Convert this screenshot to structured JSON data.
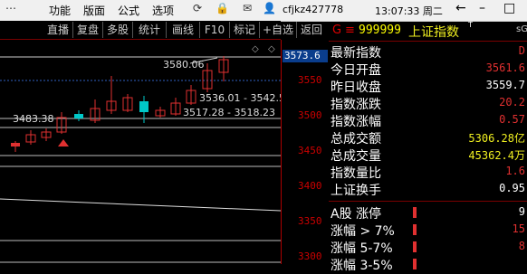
{
  "menu": {
    "items": [
      "功能",
      "版面",
      "公式",
      "选项"
    ],
    "user": "cfjkz427778",
    "clock": "13:07:33 周二",
    "win_min": "–",
    "win_max": "□"
  },
  "toolbar": [
    "直播",
    "复盘",
    "多股",
    "统计",
    "画线",
    "F10",
    "标记",
    "+自选",
    "返回"
  ],
  "axis": {
    "current": "3573.6",
    "ticks": [
      "3550",
      "3500",
      "3450",
      "3400",
      "3350",
      "3300"
    ]
  },
  "chart_labels": {
    "high": "3580.06",
    "range1": "3536.01 - 3542.5",
    "range2": "3517.28 - 3518.23",
    "level": "3483.38"
  },
  "quote": {
    "marker": "G",
    "code": "999999",
    "name": "上证指数",
    "sup": "T",
    "signal": "sG"
  },
  "stats": [
    {
      "label": "最新指数",
      "value": "D"
    },
    {
      "label": "今日开盘",
      "value": "3561.6"
    },
    {
      "label": "昨日收盘",
      "value": "3559.7"
    },
    {
      "label": "指数涨跌",
      "value": "20.2"
    },
    {
      "label": "指数涨幅",
      "value": "0.57"
    },
    {
      "label": "总成交额",
      "value": "5306.28亿"
    },
    {
      "label": "总成交量",
      "value": "45362.4万"
    },
    {
      "label": "指数量比",
      "value": "1.6"
    },
    {
      "label": "上证换手",
      "value": "0.95"
    }
  ],
  "breadth": [
    {
      "label": "A股 涨停",
      "value": "9"
    },
    {
      "label": "涨幅 > 7%",
      "value": "15"
    },
    {
      "label": "涨幅 5-7%",
      "value": "8"
    },
    {
      "label": "涨幅 3-5%",
      "value": ""
    }
  ],
  "colors": {
    "up": "#e03030",
    "down": "#00c8c8",
    "bg": "#000000",
    "accent": "#f0f020"
  }
}
